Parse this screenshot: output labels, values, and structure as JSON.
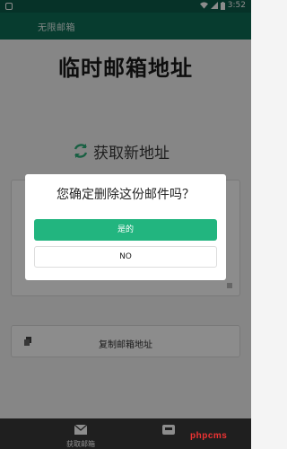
{
  "status_bar": {
    "time": "3:52"
  },
  "app_bar": {
    "title": "无限邮箱"
  },
  "main": {
    "title": "临时邮箱地址",
    "refresh_label": "获取新地址",
    "copy_label": "复制邮箱地址"
  },
  "bottom_nav": {
    "items": [
      {
        "label": "获取邮箱",
        "icon": "mail-icon"
      },
      {
        "label": "",
        "icon": "inbox-icon"
      }
    ]
  },
  "dialog": {
    "message": "您确定删除这份邮件吗？",
    "confirm_label": "是的",
    "cancel_label": "NO"
  },
  "watermark": {
    "text": "phpcms"
  },
  "colors": {
    "status_bar": "#0b5b49",
    "app_bar": "#0e6e57",
    "confirm": "#22b57f",
    "refresh_icon": "#2fb07a",
    "nav_bg": "#3a3a3a",
    "watermark": "#ee3333"
  }
}
